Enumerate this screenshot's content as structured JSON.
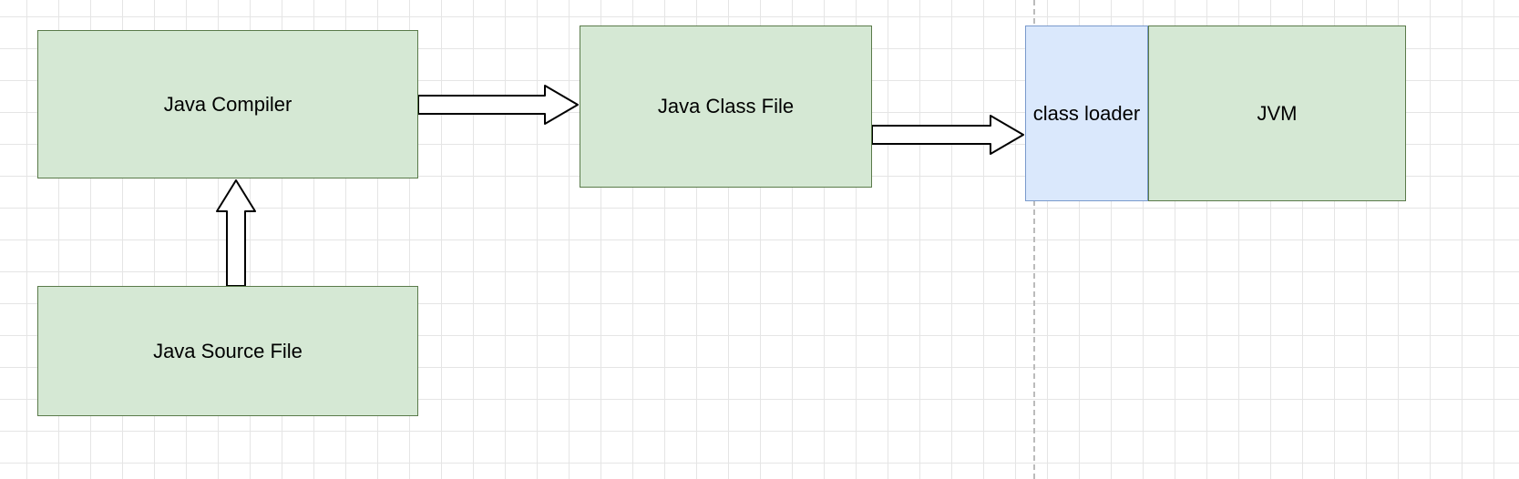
{
  "diagram": {
    "boxes": {
      "java_compiler": "Java Compiler",
      "java_source_file": "Java Source File",
      "java_class_file": "Java Class File",
      "class_loader": "class loader",
      "jvm": "JVM"
    },
    "colors": {
      "green_fill": "#d5e8d4",
      "green_border": "#5a7a4a",
      "blue_fill": "#dae8fc",
      "blue_border": "#7a9acc",
      "grid": "#e5e5e5",
      "dashed": "#bbb"
    }
  }
}
